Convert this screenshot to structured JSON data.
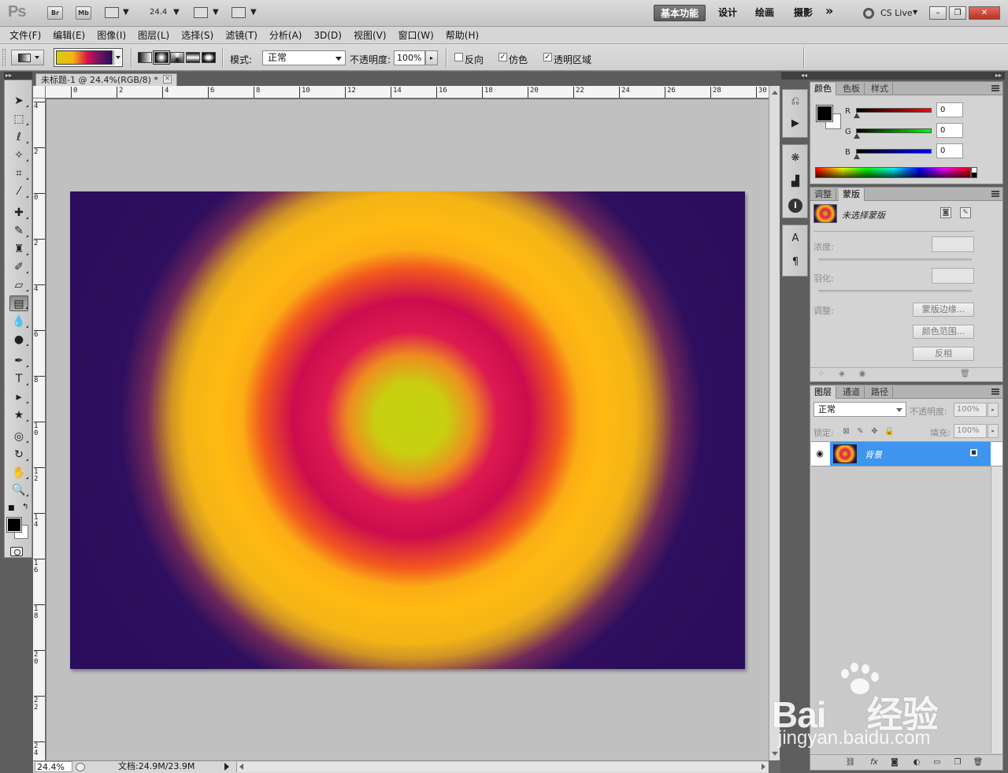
{
  "appbar": {
    "logo": "Ps",
    "bridge": "Br",
    "minibridge": "Mb",
    "zoom": "24.4",
    "workspaces": [
      "基本功能",
      "设计",
      "绘画",
      "摄影"
    ],
    "more": "»",
    "cslive": "CS Live"
  },
  "menu": [
    "文件(F)",
    "编辑(E)",
    "图像(I)",
    "图层(L)",
    "选择(S)",
    "滤镜(T)",
    "分析(A)",
    "3D(D)",
    "视图(V)",
    "窗口(W)",
    "帮助(H)"
  ],
  "options": {
    "mode_label": "模式:",
    "mode_value": "正常",
    "opacity_label": "不透明度:",
    "opacity_value": "100%",
    "reverse_label": "反向",
    "dither_label": "仿色",
    "transparency_label": "透明区域",
    "reverse_checked": false,
    "dither_checked": true,
    "transparency_checked": true
  },
  "document": {
    "tab_title": "未标题-1 @ 24.4%(RGB/8) *",
    "close": "×",
    "ruler_h": [
      "0",
      "2",
      "4",
      "6",
      "8",
      "10",
      "12",
      "14",
      "16",
      "18",
      "20",
      "22",
      "24",
      "26",
      "28",
      "30"
    ],
    "ruler_v": [
      "4",
      "2",
      "0",
      "2",
      "4",
      "6",
      "8",
      "1\n0",
      "1\n2",
      "1\n4",
      "1\n6",
      "1\n8",
      "2\n0",
      "2\n2",
      "2\n4"
    ]
  },
  "status": {
    "zoom": "24.4%",
    "doc": "文档:24.9M/23.9M"
  },
  "color_panel": {
    "tabs": [
      "颜色",
      "色板",
      "样式"
    ],
    "r_label": "R",
    "g_label": "G",
    "b_label": "B",
    "r": "0",
    "g": "0",
    "b": "0"
  },
  "mask_panel": {
    "tabs": [
      "调整",
      "蒙版"
    ],
    "title": "未选择蒙版",
    "density_label": "浓度:",
    "feather_label": "羽化:",
    "adjust_label": "调整:",
    "btn_edge": "蒙版边缘...",
    "btn_range": "颜色范围...",
    "btn_invert": "反相"
  },
  "layers_panel": {
    "tabs": [
      "图层",
      "通道",
      "路径"
    ],
    "blend_mode": "正常",
    "opacity_label": "不透明度:",
    "opacity": "100%",
    "lock_label": "锁定:",
    "fill_label": "填充:",
    "fill": "100%",
    "layer_name": "背景",
    "footer_fx": "fx"
  },
  "watermark": {
    "brand": "Bai",
    "brand2": "经验",
    "url": "jingyan.baidu.com"
  }
}
